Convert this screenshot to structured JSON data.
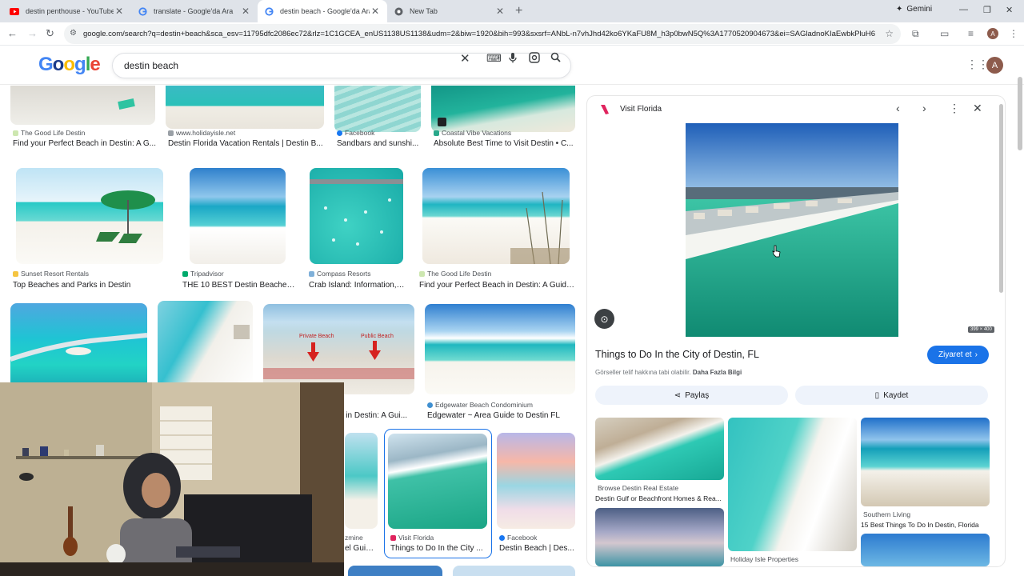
{
  "browser": {
    "tabs": [
      {
        "title": "destin penthouse - YouTube",
        "icon": "youtube-icon",
        "active": false
      },
      {
        "title": "translate - Google'da Ara",
        "icon": "google-icon",
        "active": false
      },
      {
        "title": "destin beach - Google'da Ara",
        "icon": "google-icon",
        "active": true
      },
      {
        "title": "New Tab",
        "icon": "chrome-icon",
        "active": false
      }
    ],
    "gemini_label": "Gemini",
    "url": "google.com/search?q=destin+beach&sca_esv=11795dfc2086ec72&rlz=1C1GCEA_enUS1138US1138&udm=2&biw=1920&bih=993&sxsrf=ANbL-n7vhJhd42ko6YKaFU8M_h3p0bwN5Q%3A1770520904673&ei=SAGladnoKIaEwbkPluH64AU&...",
    "profile_initial": "A"
  },
  "search": {
    "query": "destin beach",
    "logo_text": "Google"
  },
  "grid": {
    "row1": [
      {
        "source": "The Good Life Destin",
        "caption": "Find your Perfect Beach in Destin: A G..."
      },
      {
        "source": "www.holidayisle.net",
        "caption": "Destin Florida Vacation Rentals | Destin B..."
      },
      {
        "source": "Facebook",
        "caption": "Sandbars and sunshi..."
      },
      {
        "source": "Coastal Vibe Vacations",
        "caption": "Absolute Best Time to Visit Destin • C..."
      }
    ],
    "row2": [
      {
        "source": "Sunset Resort Rentals",
        "caption": "Top Beaches and Parks in Destin"
      },
      {
        "source": "Tripadvisor",
        "caption": "THE 10 BEST Destin Beaches..."
      },
      {
        "source": "Compass Resorts",
        "caption": "Crab Island: Information, ..."
      },
      {
        "source": "The Good Life Destin",
        "caption": "Find your Perfect Beach in Destin: A Guide..."
      }
    ],
    "row3": [
      {
        "source": "",
        "caption": "h in Destin: A Gui..."
      },
      {
        "source": "Edgewater Beach Condominium",
        "caption": "Edgewater ~ Area Guide to Destin FL"
      }
    ],
    "row3_labels": {
      "private": "Private Beach",
      "public": "Public Beach"
    },
    "row4": [
      {
        "source": "zmine",
        "caption": "el Guid..."
      },
      {
        "source": "Visit Florida",
        "caption": "Things to Do In the City ..."
      },
      {
        "source": "Facebook",
        "caption": "Destin Beach | Des..."
      }
    ]
  },
  "panel": {
    "site": "Visit Florida",
    "dimensions": "399 × 400",
    "title": "Things to Do In the City of Destin, FL",
    "visit_label": "Ziyaret et",
    "copyright_text": "Görseller telif hakkına tabi olabilir.",
    "copyright_link": "Daha Fazla Bilgi",
    "share_label": "Paylaş",
    "save_label": "Kaydet",
    "related": [
      {
        "source": "Browse Destin Real Estate",
        "caption": "Destin Gulf or Beachfront Homes & Rea..."
      },
      {
        "source": "Holiday Isle Properties",
        "caption": ""
      },
      {
        "source": "Southern Living",
        "caption": "15 Best Things To Do In Destin, Florida"
      }
    ]
  },
  "colors": {
    "accent": "#1a73e8",
    "ocean": "#19a98b",
    "sand": "#f2f0ea"
  }
}
